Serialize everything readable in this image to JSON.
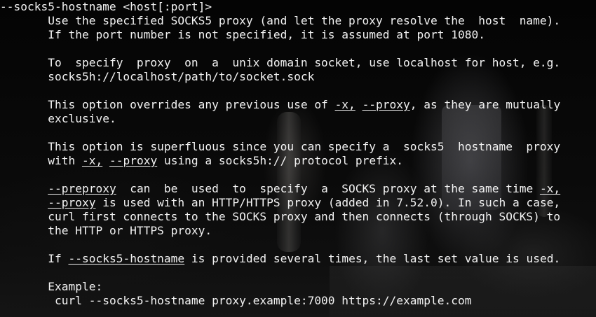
{
  "option_heading": "--socks5-hostname <host[:port]>",
  "paragraphs": {
    "p1": {
      "l1": "Use the specified SOCKS5 proxy (and let the proxy resolve the  host  name).",
      "l2": "If the port number is not specified, it is assumed at port 1080."
    },
    "p2": {
      "l1": "To  specify  proxy  on  a  unix domain socket, use localhost for host, e.g.",
      "l2": "socks5h://localhost/path/to/socket.sock"
    },
    "p3": {
      "l1_a": "This option overrides any previous use of ",
      "l1_link1": "-x,",
      "l1_b": " ",
      "l1_link2": "--proxy",
      "l1_c": ", as they are mutually",
      "l2": "exclusive."
    },
    "p4": {
      "l1": "This option is superfluous since you can specify a  socks5  hostname  proxy",
      "l2_a": "with ",
      "l2_link1": "-x,",
      "l2_b": " ",
      "l2_link2": "--proxy",
      "l2_c": " using a socks5h:// protocol prefix."
    },
    "p5": {
      "l1_link1": "--preproxy",
      "l1_a": "  can  be  used  to  specify  a  SOCKS proxy at the same time ",
      "l1_link2": "-x,",
      "l2_link1": "--proxy",
      "l2_a": " is used with an HTTP/HTTPS proxy (added in 7.52.0). In such a case,",
      "l3": "curl first connects to the SOCKS proxy and then connects (through SOCKS) to",
      "l4": "the HTTP or HTTPS proxy."
    },
    "p6": {
      "l1_a": "If ",
      "l1_link1": "--socks5-hostname",
      "l1_b": " is provided several times, the last set value is used."
    },
    "example": {
      "label": "Example:",
      "command": " curl --socks5-hostname proxy.example:7000 https://example.com"
    }
  },
  "colors": {
    "text": "#f2f2f2",
    "background": "#050505"
  }
}
